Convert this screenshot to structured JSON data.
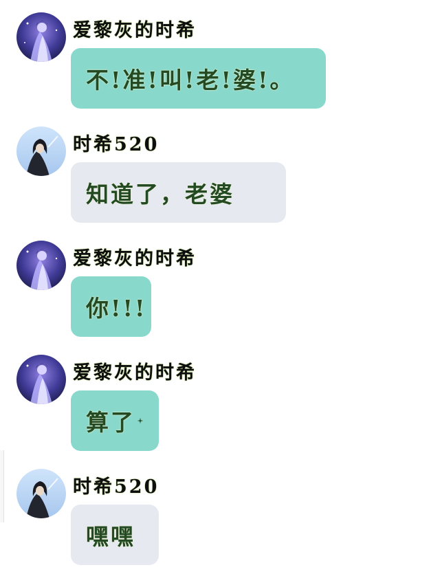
{
  "messages": [
    {
      "sender": "爱黎灰的时希",
      "avatar": "purple-anime-avatar",
      "text": "不!准!叫!老!婆!。",
      "bubble_color": "#88d8cc"
    },
    {
      "sender": "时希520",
      "avatar": "blue-anime-avatar",
      "text": "知道了，老婆",
      "bubble_color": "#e6e9f0"
    },
    {
      "sender": "爱黎灰的时希",
      "avatar": "purple-anime-avatar",
      "text": "你!!!",
      "bubble_color": "#88d8cc"
    },
    {
      "sender": "爱黎灰的时希",
      "avatar": "purple-anime-avatar",
      "text": "算了",
      "bubble_color": "#88d8cc"
    },
    {
      "sender": "时希520",
      "avatar": "blue-anime-avatar",
      "text": "嘿嘿",
      "bubble_color": "#e6e9f0"
    }
  ],
  "icons": {
    "sparkle": "sparkle-icon"
  }
}
